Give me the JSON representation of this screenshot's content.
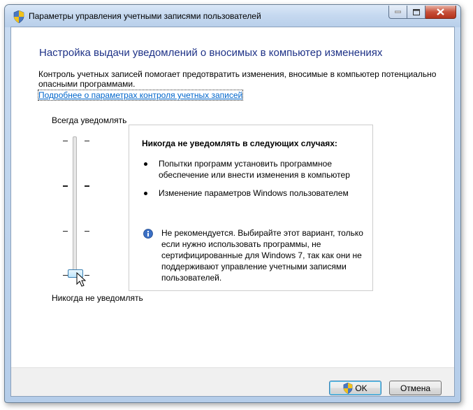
{
  "window": {
    "title": "Параметры управления учетными записями пользователей"
  },
  "main": {
    "heading": "Настройка выдачи уведомлений о вносимых в компьютер изменениях",
    "description": "Контроль учетных записей помогает предотвратить изменения, вносимые в компьютер потенциально опасными программами.",
    "link": "Подробнее о параметрах контроля учетных записей"
  },
  "slider": {
    "top_label": "Всегда уведомлять",
    "bottom_label": "Никогда не уведомлять",
    "levels": 4,
    "selected_level": 1
  },
  "info": {
    "title": "Никогда не уведомлять в следующих случаях:",
    "bullets": [
      "Попытки программ установить программное обеспечение или внести изменения в компьютер",
      "Изменение параметров Windows пользователем"
    ],
    "warning": "Не рекомендуется. Выбирайте этот вариант, только если нужно использовать программы, не сертифицированные для Windows 7, так как они не поддерживают управление учетными записями пользователей."
  },
  "buttons": {
    "ok": "OK",
    "cancel": "Отмена"
  },
  "colors": {
    "heading": "#1e3287",
    "link": "#0066cc",
    "info_icon": "#3a6fc4"
  }
}
